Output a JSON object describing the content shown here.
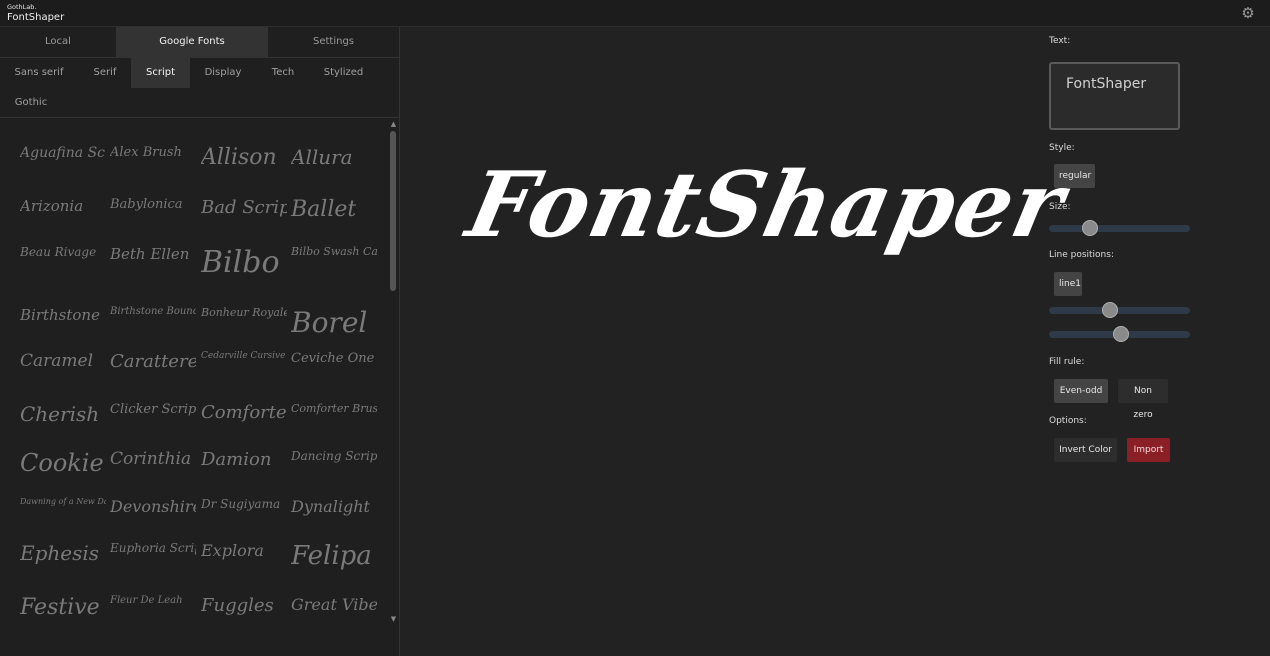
{
  "app": {
    "small_brand": "GothLab.",
    "title": "FontShaper",
    "settings_icon": "gear-icon"
  },
  "tabs": [
    {
      "label": "Local"
    },
    {
      "label": "Google Fonts",
      "active": true
    },
    {
      "label": "Settings"
    }
  ],
  "categories": [
    {
      "label": "Sans serif"
    },
    {
      "label": "Serif"
    },
    {
      "label": "Script",
      "active": true
    },
    {
      "label": "Display"
    },
    {
      "label": "Tech"
    },
    {
      "label": "Stylized"
    },
    {
      "label": "Gothic"
    }
  ],
  "fonts": [
    "Aguafina Script",
    "Alex Brush",
    "Allison",
    "Allura",
    "Arizonia",
    "Babylonica",
    "Bad Script",
    "Ballet",
    "Beau Rivage",
    "Beth Ellen",
    "Bilbo",
    "Bilbo Swash Caps",
    "Birthstone",
    "Birthstone Bounce",
    "Bonheur Royale",
    "Borel",
    "Caramel",
    "Carattere",
    "Cedarville Cursive",
    "Ceviche One",
    "Cherish",
    "Clicker Script",
    "Comforter",
    "Comforter Brush",
    "Cookie",
    "Corinthia",
    "Damion",
    "Dancing Script",
    "Dawning of a New Day",
    "Devonshire",
    "Dr Sugiyama",
    "Dynalight",
    "Ephesis",
    "Euphoria Script",
    "Explora",
    "Felipa",
    "Festive",
    "Fleur De Leah",
    "Fuggles",
    "Great Vibes"
  ],
  "preview": {
    "text": "FontShaper"
  },
  "controls": {
    "text_label": "Text:",
    "text_value": "FontShaper",
    "style_label": "Style:",
    "style_value": "regular",
    "size_label": "Size:",
    "size_level": 0.26,
    "line_label": "Line positions:",
    "line_value": "line1",
    "line_slider1": 0.42,
    "line_slider2": 0.51,
    "fill_label": "Fill rule:",
    "fill_options": [
      "Even-odd",
      "Non zero"
    ],
    "options_label": "Options:",
    "invert_label": "Invert Color",
    "import_label": "Import",
    "colors": {
      "accent_red": "#8a1f25",
      "slider_track": "#2e3a47"
    }
  }
}
